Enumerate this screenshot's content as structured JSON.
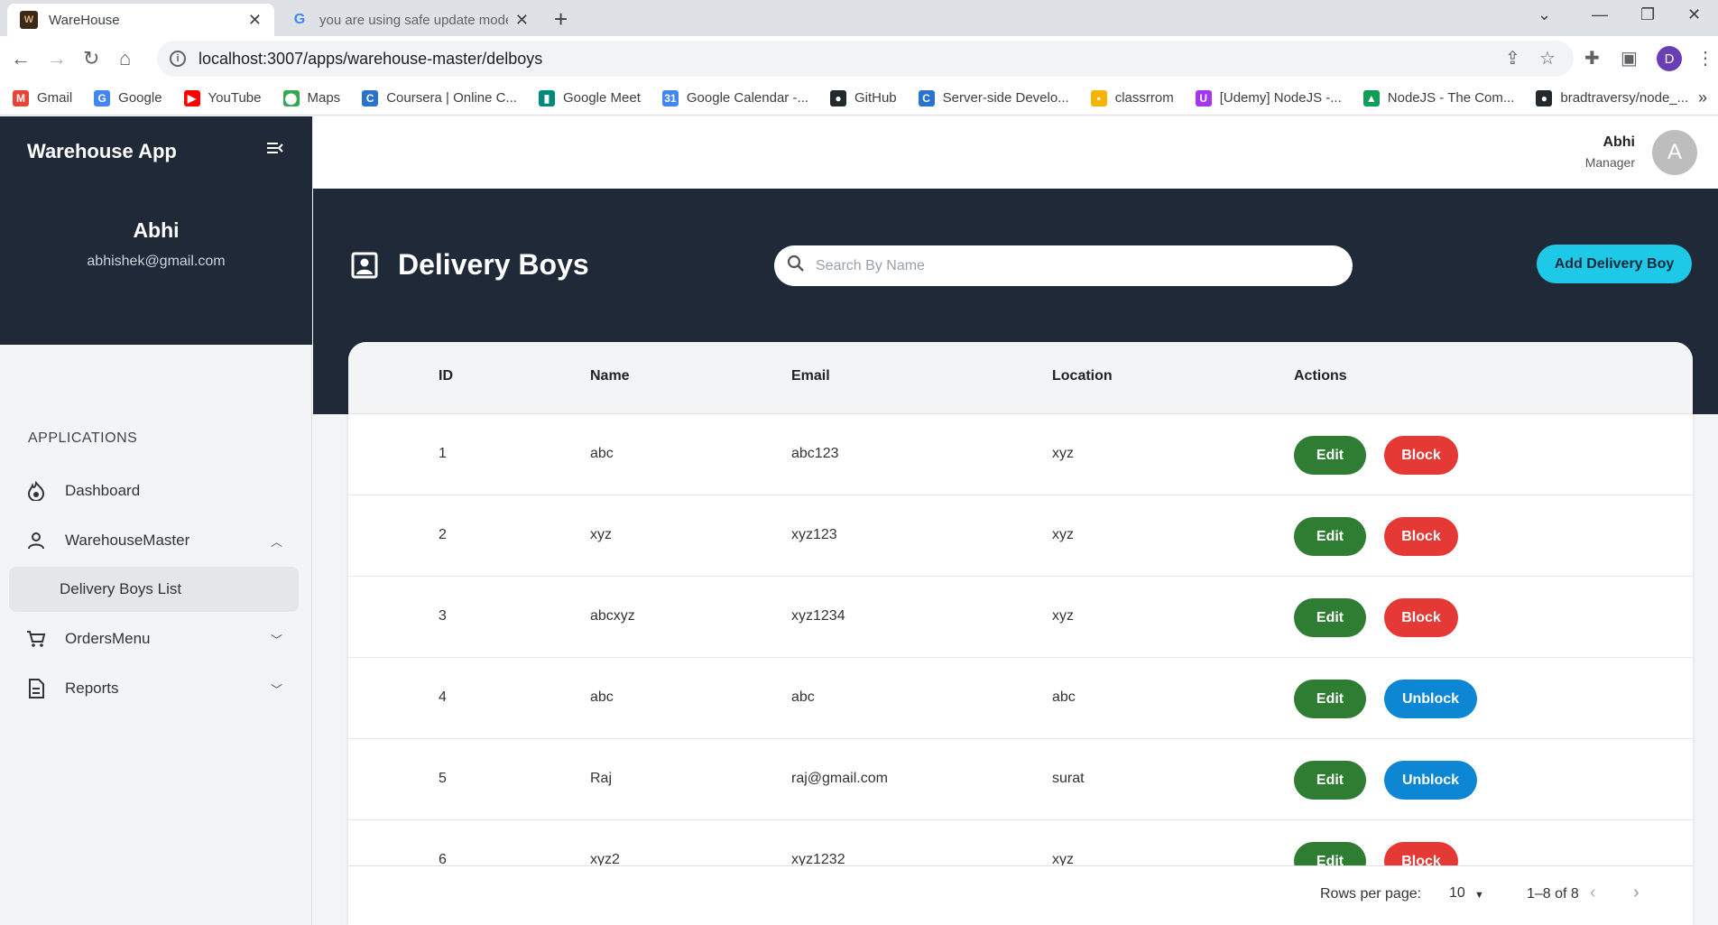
{
  "browser": {
    "tabs": [
      {
        "title": "WareHouse",
        "active": true
      },
      {
        "title": "you are using safe update mode",
        "active": false
      }
    ],
    "url": "localhost:3007/apps/warehouse-master/delboys",
    "profile_initial": "D",
    "bookmarks": [
      {
        "label": "Gmail",
        "icon": "gmail-icon",
        "color": "#ea4335"
      },
      {
        "label": "Google",
        "icon": "google-icon",
        "color": "#4285f4"
      },
      {
        "label": "YouTube",
        "icon": "youtube-icon",
        "color": "#ff0000"
      },
      {
        "label": "Maps",
        "icon": "maps-icon",
        "color": "#34a853"
      },
      {
        "label": "Coursera | Online C...",
        "icon": "coursera-icon",
        "color": "#2a73cc"
      },
      {
        "label": "Google Meet",
        "icon": "meet-icon",
        "color": "#00897b"
      },
      {
        "label": "Google Calendar -...",
        "icon": "calendar-icon",
        "color": "#4285f4"
      },
      {
        "label": "GitHub",
        "icon": "github-icon",
        "color": "#24292e"
      },
      {
        "label": "Server-side Develo...",
        "icon": "coursera-icon",
        "color": "#2a73cc"
      },
      {
        "label": "classrrom",
        "icon": "classroom-icon",
        "color": "#f4b400"
      },
      {
        "label": "[Udemy] NodeJS -...",
        "icon": "udemy-icon",
        "color": "#a435f0"
      },
      {
        "label": "NodeJS - The Com...",
        "icon": "drive-icon",
        "color": "#0f9d58"
      },
      {
        "label": "bradtraversy/node_...",
        "icon": "github-icon",
        "color": "#24292e"
      }
    ]
  },
  "sidebar": {
    "brand": "Warehouse App",
    "user_name": "Abhi",
    "user_email": "abhishek@gmail.com",
    "section_label": "APPLICATIONS",
    "items": [
      {
        "label": "Dashboard",
        "icon": "dashboard-icon"
      },
      {
        "label": "WarehouseMaster",
        "icon": "person-icon"
      },
      {
        "label": "Delivery Boys List"
      },
      {
        "label": "OrdersMenu",
        "icon": "cart-icon"
      },
      {
        "label": "Reports",
        "icon": "report-icon"
      }
    ]
  },
  "topbar": {
    "user_name": "Abhi",
    "user_role": "Manager",
    "avatar_initial": "A"
  },
  "page": {
    "title": "Delivery Boys",
    "search_placeholder": "Search By Name",
    "add_button": "Add Delivery Boy"
  },
  "table": {
    "columns": [
      "ID",
      "Name",
      "Email",
      "Location",
      "Actions"
    ],
    "edit_label": "Edit",
    "rows": [
      {
        "id": "1",
        "name": "abc",
        "email": "abc123",
        "location": "xyz",
        "status_action": "Block"
      },
      {
        "id": "2",
        "name": "xyz",
        "email": "xyz123",
        "location": "xyz",
        "status_action": "Block"
      },
      {
        "id": "3",
        "name": "abcxyz",
        "email": "xyz1234",
        "location": "xyz",
        "status_action": "Block"
      },
      {
        "id": "4",
        "name": "abc",
        "email": "abc",
        "location": "abc",
        "status_action": "Unblock"
      },
      {
        "id": "5",
        "name": "Raj",
        "email": "raj@gmail.com",
        "location": "surat",
        "status_action": "Unblock"
      },
      {
        "id": "6",
        "name": "xyz2",
        "email": "xyz1232",
        "location": "xyz",
        "status_action": "Block"
      }
    ]
  },
  "pagination": {
    "rows_per_page_label": "Rows per page:",
    "rows_per_page": "10",
    "range": "1–8 of 8"
  },
  "colors": {
    "dark_header": "#1f2937",
    "accent_cyan": "#1ec8e7",
    "edit_green": "#2e7d32",
    "block_red": "#e53935",
    "unblock_blue": "#0d86d3"
  }
}
